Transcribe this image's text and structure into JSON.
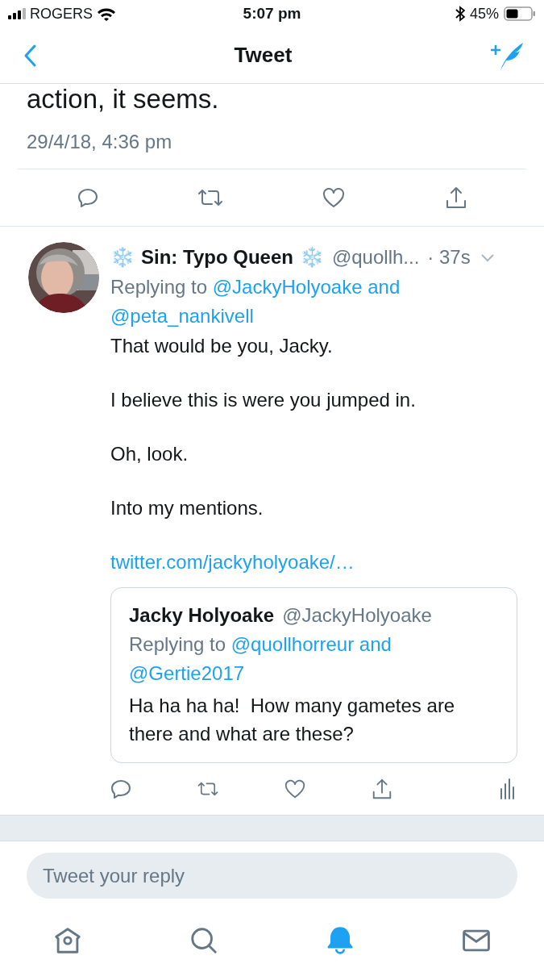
{
  "status_bar": {
    "carrier": "ROGERS",
    "time": "5:07 pm",
    "battery": "45%"
  },
  "nav": {
    "title": "Tweet"
  },
  "main_tweet": {
    "text_tail": "action, it seems.",
    "timestamp": "29/4/18, 4:36 pm"
  },
  "main_actions": [
    {
      "kind": "reply"
    },
    {
      "kind": "retweet"
    },
    {
      "kind": "like"
    },
    {
      "kind": "share"
    }
  ],
  "reply": {
    "emoji_before": "❄️",
    "display_name": "Sin: Typo Queen",
    "emoji_after": "❄️",
    "handle": "@quollh...",
    "age": "· 37s",
    "replying_label": "Replying to",
    "mentions": [
      "@JackyHolyoake",
      "@peta_nankivell"
    ],
    "joiner": "and",
    "paragraphs": [
      "That would be you, Jacky.",
      "I believe this is were you jumped in.",
      "Oh, look.",
      "Into my mentions."
    ],
    "link": "twitter.com/jackyholyoake/…",
    "quote": {
      "display_name": "Jacky Holyoake",
      "handle": "@JackyHolyoake",
      "replying_label": "Replying to",
      "mentions": [
        "@quollhorreur",
        "@Gertie2017"
      ],
      "joiner": "and",
      "text": "Ha ha ha ha!  How many gametes are there and what are these?"
    },
    "actions": [
      {
        "kind": "reply"
      },
      {
        "kind": "retweet"
      },
      {
        "kind": "like"
      },
      {
        "kind": "share"
      },
      {
        "kind": "analytics"
      }
    ]
  },
  "composer": {
    "placeholder": "Tweet your reply"
  },
  "tabs": [
    {
      "kind": "home",
      "selected": false
    },
    {
      "kind": "search",
      "selected": false
    },
    {
      "kind": "notifications",
      "selected": true
    },
    {
      "kind": "messages",
      "selected": false
    }
  ]
}
